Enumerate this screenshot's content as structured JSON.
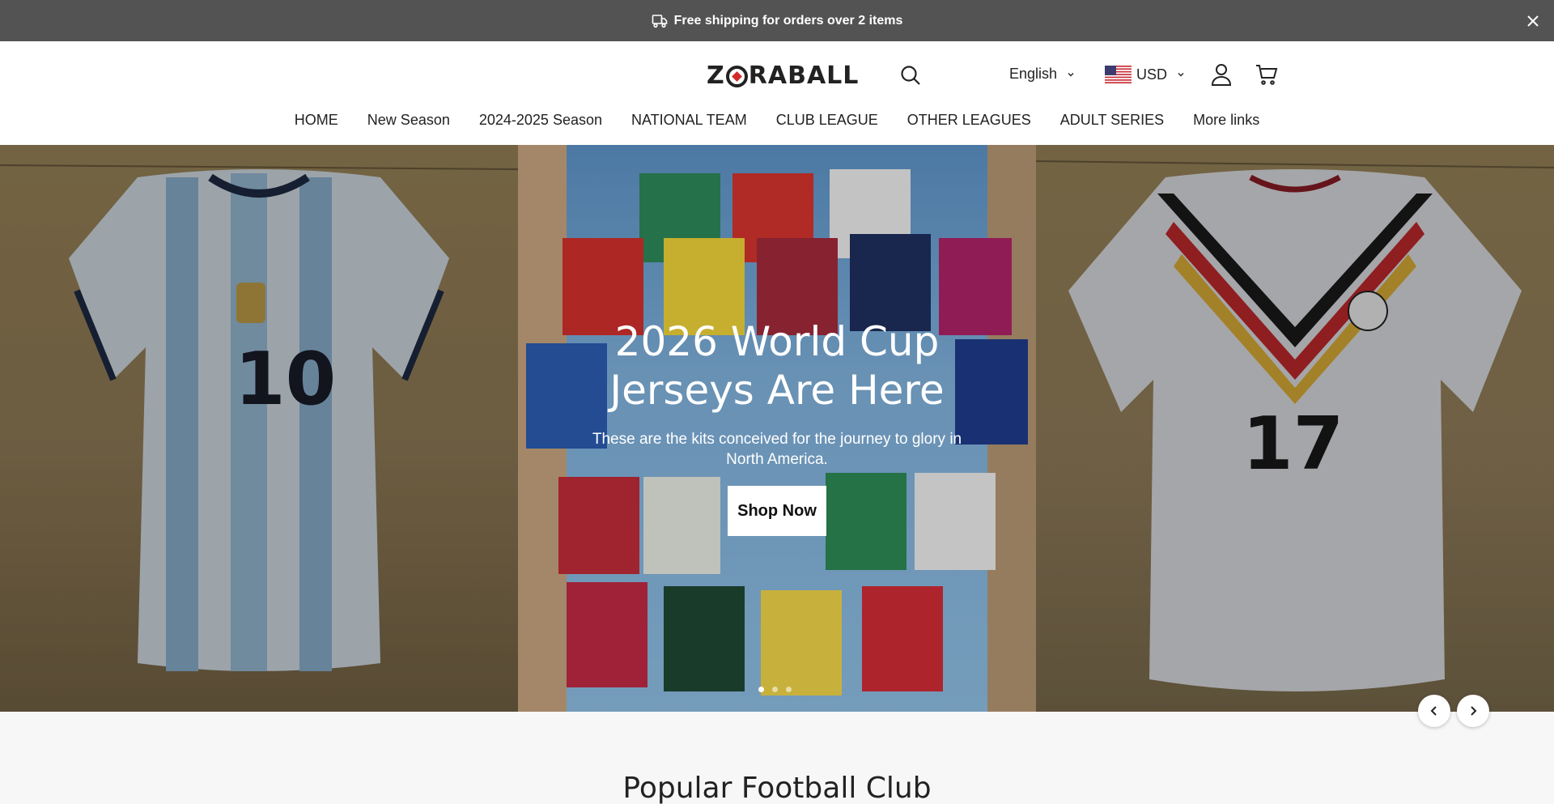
{
  "announcement": {
    "text": "Free shipping for orders over 2 items",
    "icon": "truck-icon"
  },
  "header": {
    "logo": {
      "pre": "Z",
      "post": "RABALL"
    },
    "language": "English",
    "currency": "USD",
    "icons": [
      "search-icon",
      "account-icon",
      "cart-icon"
    ]
  },
  "nav": [
    {
      "label": "HOME"
    },
    {
      "label": "New Season"
    },
    {
      "label": "2024-2025 Season"
    },
    {
      "label": "NATIONAL TEAM"
    },
    {
      "label": "CLUB LEAGUE"
    },
    {
      "label": "OTHER LEAGUES"
    },
    {
      "label": "ADULT SERIES"
    },
    {
      "label": "More links"
    }
  ],
  "hero": {
    "title_line1": "2026 World Cup",
    "title_line2": "Jerseys Are Here",
    "subtitle": "These are the kits conceived for the journey to glory in North America.",
    "cta": "Shop Now",
    "slides_total": 3,
    "active_slide": 1,
    "left_jersey_number": "10",
    "right_jersey_number": "17"
  },
  "section": {
    "title": "Popular Football Club"
  },
  "colors": {
    "announcement_bg": "#535353",
    "accent_red": "#d32a2a"
  }
}
